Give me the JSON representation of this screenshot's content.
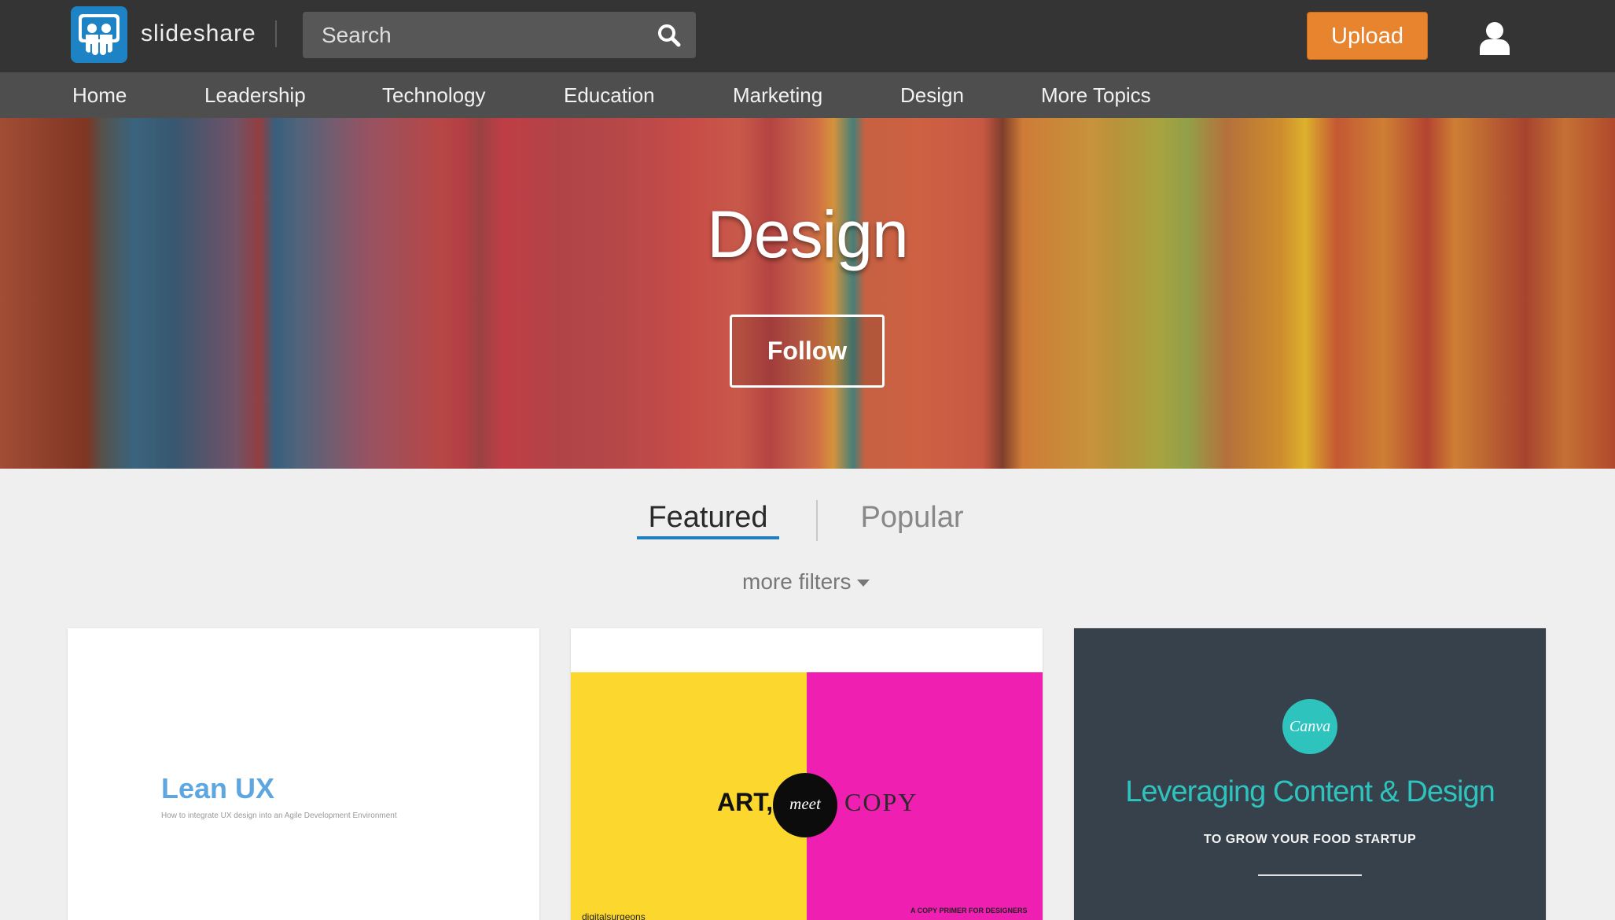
{
  "header": {
    "brand": "slideshare",
    "search_placeholder": "Search",
    "upload_label": "Upload"
  },
  "nav": {
    "items": [
      "Home",
      "Leadership",
      "Technology",
      "Education",
      "Marketing",
      "Design",
      "More Topics"
    ]
  },
  "hero": {
    "title": "Design",
    "follow_label": "Follow"
  },
  "tabs": {
    "featured": "Featured",
    "popular": "Popular",
    "active": "Featured"
  },
  "filters_label": "more filters",
  "cards": [
    {
      "title": "Lean UX",
      "subtitle": "How to integrate UX design into an Agile Development Environment"
    },
    {
      "art": "ART,",
      "meet": "meet",
      "copy": "COPY",
      "primer": "A COPY PRIMER FOR DESIGNERS",
      "publisher": "digitalsurgeons"
    },
    {
      "badge": "Canva",
      "title": "Leveraging Content & Design",
      "subtitle": "TO GROW YOUR FOOD STARTUP"
    }
  ],
  "colors": {
    "topbar": "#343434",
    "navbar": "#4e4e4e",
    "upload": "#e8842d",
    "tab_underline": "#1f7fc0",
    "logo": "#1d83c4",
    "canva_teal": "#2fc3be"
  },
  "icons": {
    "logo": "slideshare-logo",
    "search": "search-icon",
    "user": "user-icon",
    "filters": "caret-down-icon"
  }
}
